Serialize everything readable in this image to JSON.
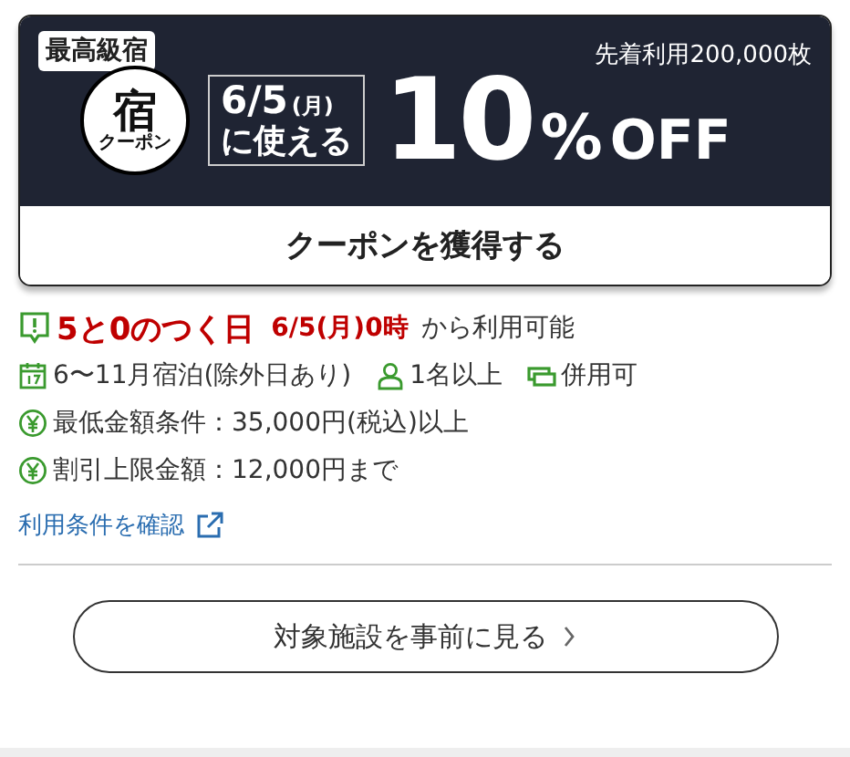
{
  "coupon": {
    "badge": "最高級宿",
    "quantity": "先着利用200,000枚",
    "logo": {
      "main": "宿",
      "sub": "クーポン"
    },
    "date": "6/5",
    "weekday": "(月)",
    "date_suffix": "に使える",
    "discount": "10",
    "discount_unit": "%",
    "discount_suffix": "OFF",
    "get_button": "クーポンを獲得する"
  },
  "details": {
    "campaign": "5と0のつく日",
    "start": "6/5(月)0時",
    "start_suffix": "から利用可能",
    "conditions": [
      {
        "kind": "calendar",
        "text": "6〜11月宿泊(除外日あり)"
      },
      {
        "kind": "person",
        "text": "1名以上"
      },
      {
        "kind": "ticket",
        "text": "併用可"
      }
    ],
    "amounts": [
      {
        "kind": "yen",
        "text": "最低金額条件：35,000円(税込)以上"
      },
      {
        "kind": "yen",
        "text": "割引上限金額：12,000円まで"
      }
    ],
    "terms_link": "利用条件を確認"
  },
  "footer_button": "対象施設を事前に見る"
}
